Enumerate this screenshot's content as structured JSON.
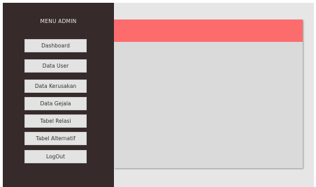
{
  "sidebar": {
    "title": "MENU ADMIN",
    "items": [
      {
        "label": "Dashboard"
      },
      {
        "label": "Data User"
      },
      {
        "label": "Data Kerusakan"
      },
      {
        "label": "Data Gejala"
      },
      {
        "label": "Tabel Relasi"
      },
      {
        "label": "Tabel Alternatif"
      },
      {
        "label": "LogOut"
      }
    ]
  },
  "colors": {
    "sidebar_bg": "#362b2a",
    "accent_header": "#fd6c6d",
    "content_bg": "#dadada",
    "button_bg": "#e3e3e3"
  }
}
